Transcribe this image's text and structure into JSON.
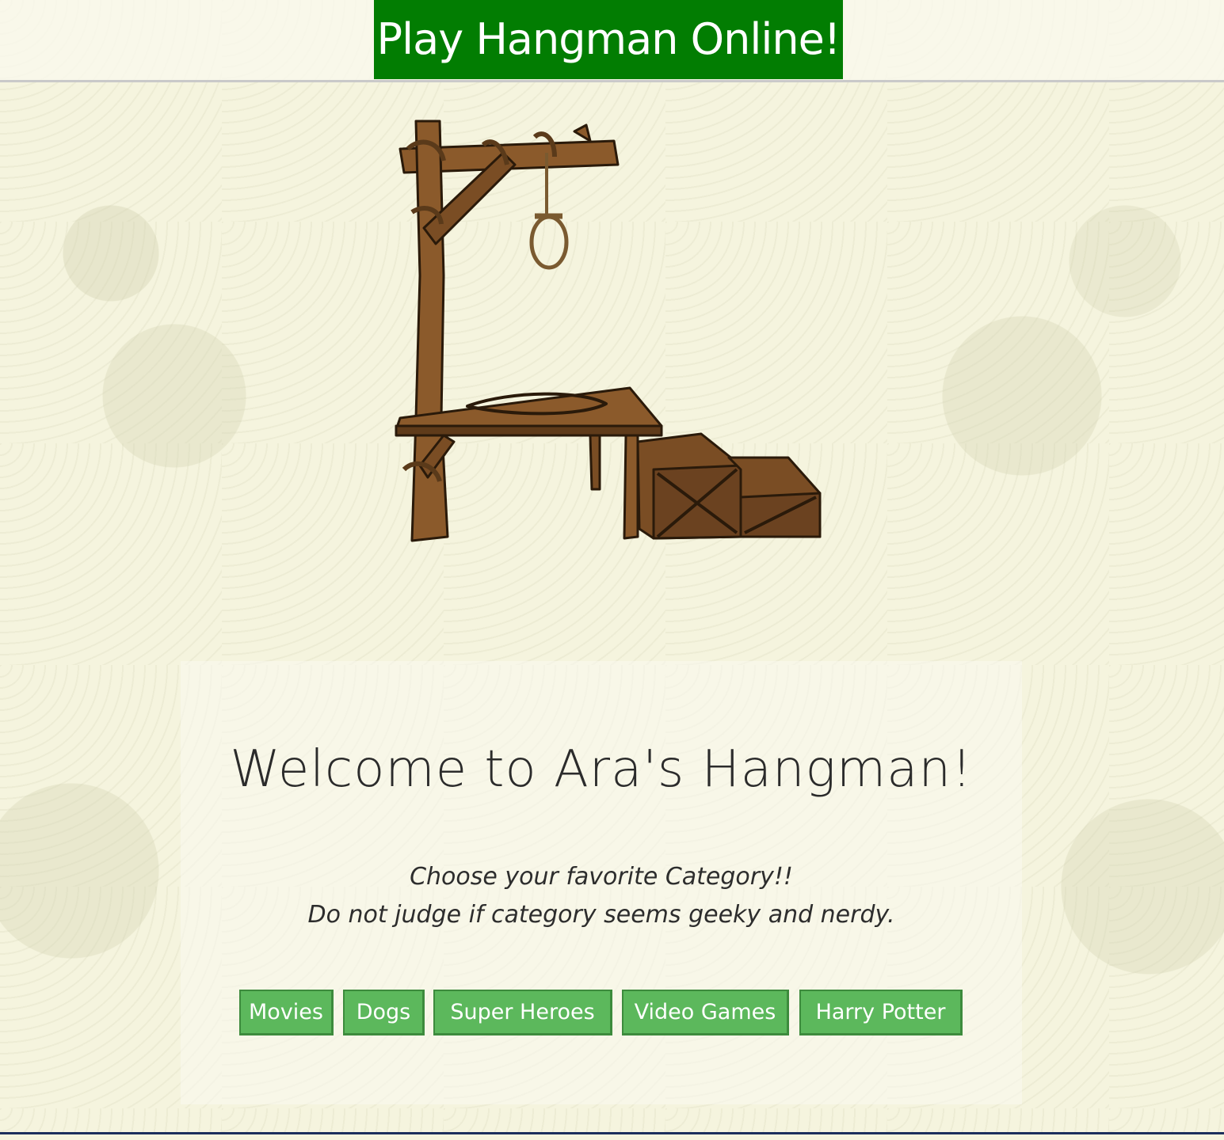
{
  "header": {
    "title": "Play Hangman Online!",
    "title_bg": "#027d02"
  },
  "hero": {
    "image": "gallows-illustration"
  },
  "welcome": {
    "heading": "Welcome to Ara's Hangman!",
    "line1": "Choose your favorite Category!!",
    "line2": "Do not judge if category seems geeky and nerdy."
  },
  "categories": {
    "accent": "#5cb85c",
    "items": [
      {
        "label": "Movies"
      },
      {
        "label": "Dogs"
      },
      {
        "label": "Super Heroes"
      },
      {
        "label": "Video Games"
      },
      {
        "label": "Harry Potter"
      }
    ]
  }
}
